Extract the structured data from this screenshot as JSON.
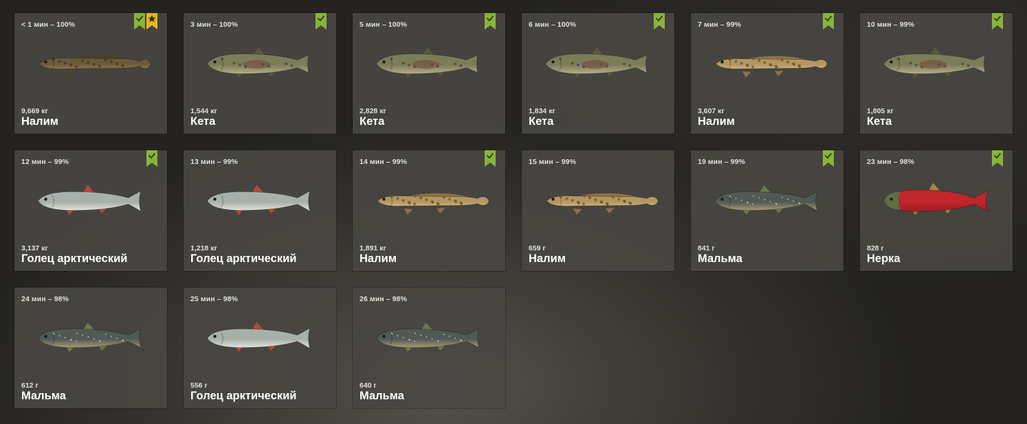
{
  "colors": {
    "check_badge": "#8ab339",
    "star_badge": "#e1b52a",
    "card_bg": "#484642",
    "text": "#ffffff"
  },
  "catches": [
    {
      "time": "< 1 мин – 100%",
      "weight": "9,669 кг",
      "name": "Налим",
      "species": "burbot",
      "checked": true,
      "starred": true
    },
    {
      "time": "3 мин – 100%",
      "weight": "1,544 кг",
      "name": "Кета",
      "species": "chum",
      "checked": true,
      "starred": false
    },
    {
      "time": "5 мин – 100%",
      "weight": "2,828 кг",
      "name": "Кета",
      "species": "chum",
      "checked": true,
      "starred": false
    },
    {
      "time": "6 мин – 100%",
      "weight": "1,834 кг",
      "name": "Кета",
      "species": "chum",
      "checked": true,
      "starred": false
    },
    {
      "time": "7 мин – 99%",
      "weight": "3,607 кг",
      "name": "Налим",
      "species": "burbot",
      "checked": true,
      "starred": false
    },
    {
      "time": "10 мин – 99%",
      "weight": "1,805 кг",
      "name": "Кета",
      "species": "chum",
      "checked": true,
      "starred": false
    },
    {
      "time": "12 мин – 99%",
      "weight": "3,137 кг",
      "name": "Голец арктический",
      "species": "char",
      "checked": true,
      "starred": false
    },
    {
      "time": "13 мин – 99%",
      "weight": "1,218 кг",
      "name": "Голец арктический",
      "species": "char",
      "checked": false,
      "starred": false
    },
    {
      "time": "14 мин – 99%",
      "weight": "1,891 кг",
      "name": "Налим",
      "species": "burbot",
      "checked": true,
      "starred": false
    },
    {
      "time": "15 мин – 99%",
      "weight": "659 г",
      "name": "Налим",
      "species": "burbot",
      "checked": false,
      "starred": false
    },
    {
      "time": "19 мин – 99%",
      "weight": "841 г",
      "name": "Мальма",
      "species": "dolly",
      "checked": true,
      "starred": false
    },
    {
      "time": "23 мин – 98%",
      "weight": "828 г",
      "name": "Нерка",
      "species": "sockeye",
      "checked": true,
      "starred": false
    },
    {
      "time": "24 мин – 98%",
      "weight": "612 г",
      "name": "Мальма",
      "species": "dolly",
      "checked": false,
      "starred": false
    },
    {
      "time": "25 мин – 98%",
      "weight": "556 г",
      "name": "Голец арктический",
      "species": "char",
      "checked": false,
      "starred": false
    },
    {
      "time": "26 мин – 98%",
      "weight": "640 г",
      "name": "Мальма",
      "species": "dolly",
      "checked": false,
      "starred": false
    }
  ]
}
